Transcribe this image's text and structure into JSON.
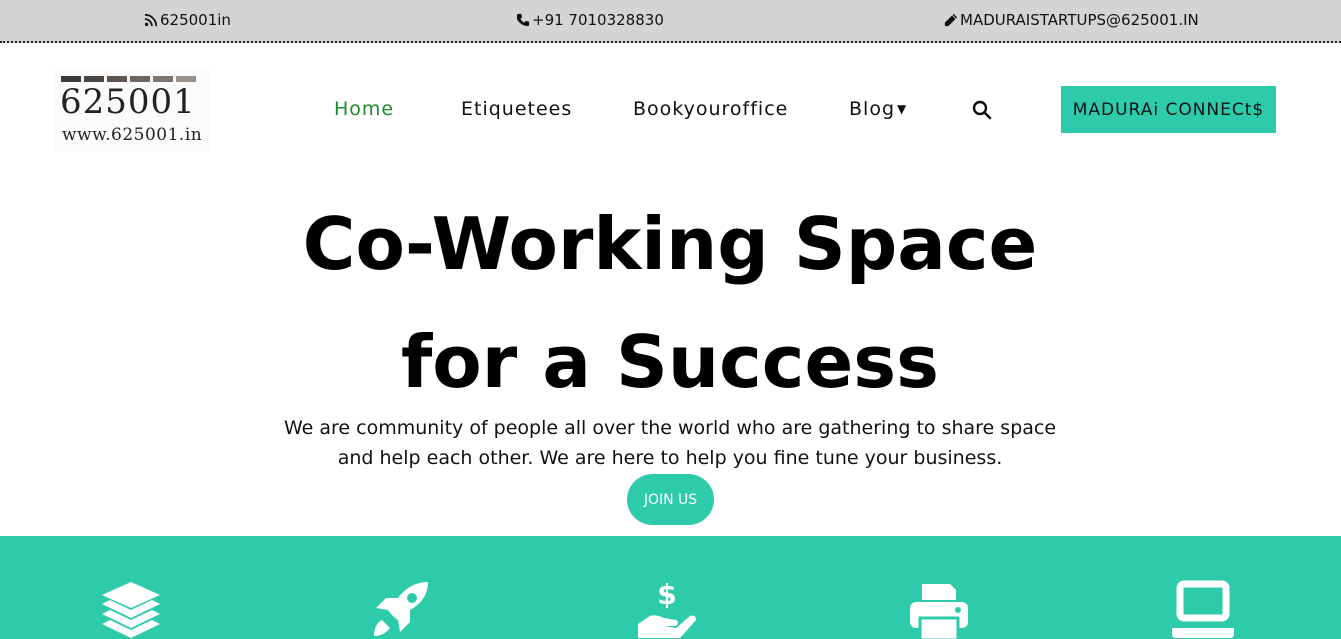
{
  "topbar": {
    "website": "625001in",
    "phone": "+91 7010328830",
    "email": "MADURAISTARTUPS@625001.IN"
  },
  "logo": {
    "number": "625001",
    "url": "www.625001.in",
    "bar_colors": [
      "#3a3a3a",
      "#4a4440",
      "#5e5550",
      "#6e6560",
      "#7e7570",
      "#9a8f88"
    ]
  },
  "nav": {
    "items": [
      {
        "label": "Home",
        "active": true
      },
      {
        "label": "Etiquetees"
      },
      {
        "label": "Bookyouroffice"
      },
      {
        "label": "Blog"
      }
    ],
    "cta": "MADURAi CONNECt$"
  },
  "hero": {
    "title_line1": "Co-Working Space",
    "title_line2": "for a Success",
    "desc_line1": "We are community of people all over the world who are gathering to share space",
    "desc_line2": "and help each other. We are here to help you fine tune your business.",
    "button": "JOIN US"
  },
  "features": {
    "icons": [
      "layers-icon",
      "rocket-icon",
      "hand-dollar-icon",
      "printer-icon",
      "laptop-icon"
    ]
  },
  "colors": {
    "accent": "#2ecbab",
    "active_nav": "#1f8a2f",
    "topbar_bg": "#d4d4d4"
  }
}
